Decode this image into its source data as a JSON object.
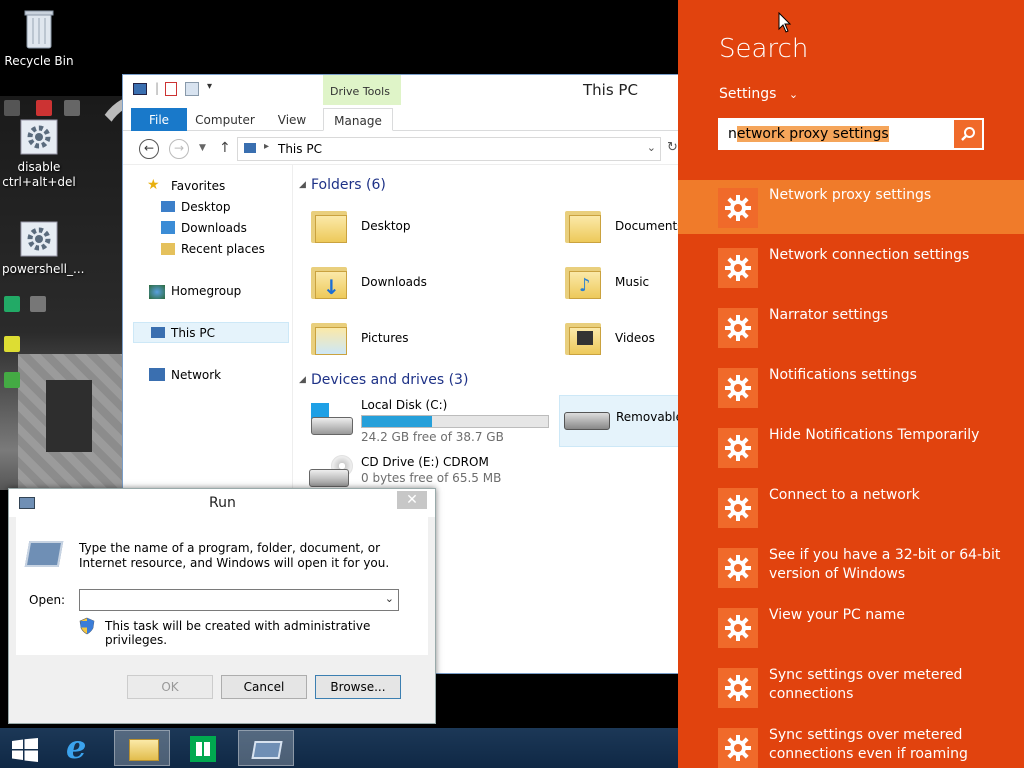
{
  "desktop": {
    "recycle_bin": "Recycle Bin",
    "shortcut1": "disable ctrl+alt+del",
    "shortcut2": "powershell_..."
  },
  "explorer": {
    "title": "This PC",
    "contextual_tab_group": "Drive Tools",
    "tabs": [
      "File",
      "Computer",
      "View",
      "Manage"
    ],
    "address": "This PC",
    "nav": {
      "favorites": "Favorites",
      "desktop": "Desktop",
      "downloads": "Downloads",
      "recent": "Recent places",
      "homegroup": "Homegroup",
      "thispc": "This PC",
      "network": "Network"
    },
    "folders_header": "Folders (6)",
    "folders": [
      "Desktop",
      "Documents",
      "Downloads",
      "Music",
      "Pictures",
      "Videos"
    ],
    "devices_header": "Devices and drives (3)",
    "drives": {
      "c_name": "Local Disk (C:)",
      "c_free": "24.2 GB free of 38.7 GB",
      "c_used_fraction": 0.375,
      "e_name": "CD Drive (E:) CDROM",
      "e_free": "0 bytes free of 65.5 MB",
      "removable": "Removable"
    }
  },
  "run": {
    "title": "Run",
    "description": "Type the name of a program, folder, document, or Internet resource, and Windows will open it for you.",
    "open_label": "Open:",
    "open_value": "",
    "admin_note": "This task will be created with administrative privileges.",
    "ok": "OK",
    "cancel": "Cancel",
    "browse": "Browse..."
  },
  "charm": {
    "title": "Search",
    "scope": "Settings",
    "query": "network proxy settings",
    "query_first_char": "n",
    "query_rest": "etwork proxy settings",
    "results": [
      "Network proxy settings",
      "Network connection settings",
      "Narrator settings",
      "Notifications settings",
      "Hide Notifications Temporarily",
      "Connect to a network",
      "See if you have a 32-bit or 64-bit version of Windows",
      "View your PC name",
      "Sync settings over metered connections",
      "Sync settings over metered connections even if roaming"
    ],
    "selected_index": 0,
    "colors": {
      "background": "#e1430e",
      "selected": "#f07b2a",
      "icon_bg": "#f06a2a"
    }
  }
}
